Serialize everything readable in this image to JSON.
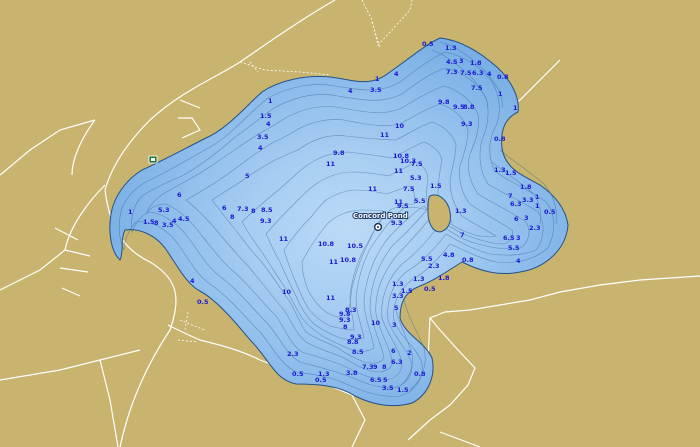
{
  "map": {
    "pond_name": "Concord Pond",
    "colors": {
      "land": "#c8b46e",
      "water_shallow": "#7cb1e6",
      "water_mid": "#9bc6ef",
      "water_deep": "#bcdaf6",
      "contour": "#2e5f96",
      "depth_label": "#1a17d6",
      "road": "#ffffff"
    },
    "icons": [
      "marker-icon",
      "flag-icon"
    ]
  },
  "soundings": [
    {
      "v": "0.5"
    },
    {
      "v": "1.3"
    },
    {
      "v": "4.5"
    },
    {
      "v": "3"
    },
    {
      "v": "1.8"
    },
    {
      "v": "7.3"
    },
    {
      "v": "7.5"
    },
    {
      "v": "6.3"
    },
    {
      "v": "4"
    },
    {
      "v": "0.8"
    },
    {
      "v": "1"
    },
    {
      "v": "4"
    },
    {
      "v": "4"
    },
    {
      "v": "3.5"
    },
    {
      "v": "1"
    },
    {
      "v": "9.8"
    },
    {
      "v": "9.5"
    },
    {
      "v": "8.8"
    },
    {
      "v": "7.5"
    },
    {
      "v": "1"
    },
    {
      "v": "1"
    },
    {
      "v": "1.5"
    },
    {
      "v": "4"
    },
    {
      "v": "3.5"
    },
    {
      "v": "4"
    },
    {
      "v": "10"
    },
    {
      "v": "9.3"
    },
    {
      "v": "11"
    },
    {
      "v": "0.8"
    },
    {
      "v": "9.8"
    },
    {
      "v": "10.8"
    },
    {
      "v": "10.3"
    },
    {
      "v": "7.5"
    },
    {
      "v": "11"
    },
    {
      "v": "11"
    },
    {
      "v": "5"
    },
    {
      "v": "11"
    },
    {
      "v": "5.3"
    },
    {
      "v": "1.3"
    },
    {
      "v": "1.5"
    },
    {
      "v": "7.5"
    },
    {
      "v": "1.5"
    },
    {
      "v": "1.8"
    },
    {
      "v": "1"
    },
    {
      "v": "11"
    },
    {
      "v": "6"
    },
    {
      "v": "9.5"
    },
    {
      "v": "5.5"
    },
    {
      "v": "7"
    },
    {
      "v": "6.3"
    },
    {
      "v": "3.3"
    },
    {
      "v": "1"
    },
    {
      "v": "0.5"
    },
    {
      "v": "5.3"
    },
    {
      "v": "6"
    },
    {
      "v": "7.3"
    },
    {
      "v": "8"
    },
    {
      "v": "8.5"
    },
    {
      "v": "8"
    },
    {
      "v": "9.3"
    },
    {
      "v": "9.3"
    },
    {
      "v": "1.3"
    },
    {
      "v": "6"
    },
    {
      "v": "3"
    },
    {
      "v": "2.3"
    },
    {
      "v": "1"
    },
    {
      "v": "1.5"
    },
    {
      "v": "8"
    },
    {
      "v": "3.5"
    },
    {
      "v": "4"
    },
    {
      "v": "4.5"
    },
    {
      "v": "11"
    },
    {
      "v": "10.8"
    },
    {
      "v": "10.5"
    },
    {
      "v": "7"
    },
    {
      "v": "6.5"
    },
    {
      "v": "3"
    },
    {
      "v": "5.5"
    },
    {
      "v": "11"
    },
    {
      "v": "10.8"
    },
    {
      "v": "4.8"
    },
    {
      "v": "5.5"
    },
    {
      "v": "0.8"
    },
    {
      "v": "4"
    },
    {
      "v": "2.3"
    },
    {
      "v": "1.3"
    },
    {
      "v": "1.8"
    },
    {
      "v": "4"
    },
    {
      "v": "1.5"
    },
    {
      "v": "1.3"
    },
    {
      "v": "3.3"
    },
    {
      "v": "0.5"
    },
    {
      "v": "0.5"
    },
    {
      "v": "10"
    },
    {
      "v": "5"
    },
    {
      "v": "11"
    },
    {
      "v": "8.3"
    },
    {
      "v": "9.8"
    },
    {
      "v": "9.3"
    },
    {
      "v": "10"
    },
    {
      "v": "8"
    },
    {
      "v": "9.3"
    },
    {
      "v": "8.8"
    },
    {
      "v": "3"
    },
    {
      "v": "8.5"
    },
    {
      "v": "6"
    },
    {
      "v": "2"
    },
    {
      "v": "2.3"
    },
    {
      "v": "6.3"
    },
    {
      "v": "7.3"
    },
    {
      "v": "9"
    },
    {
      "v": "8"
    },
    {
      "v": "0.8"
    },
    {
      "v": "0.5"
    },
    {
      "v": "1.3"
    },
    {
      "v": "0.5"
    },
    {
      "v": "3.8"
    },
    {
      "v": "6.5"
    },
    {
      "v": "5"
    },
    {
      "v": "3.5"
    },
    {
      "v": "1.5"
    }
  ]
}
